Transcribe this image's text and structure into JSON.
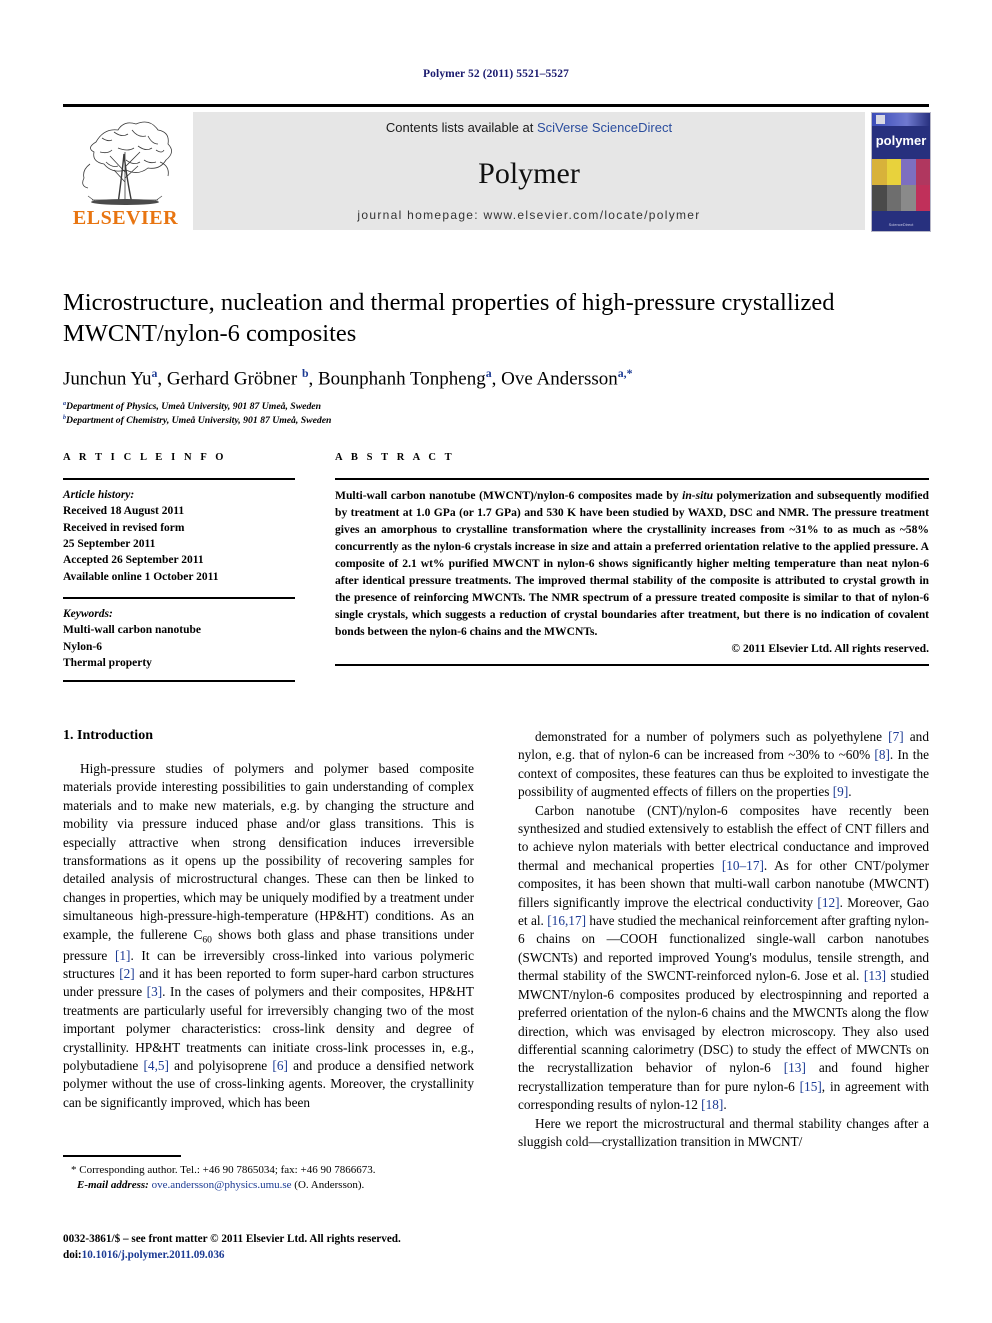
{
  "running_head": "Polymer 52 (2011) 5521–5527",
  "masthead": {
    "contents_prefix": "Contents lists available at ",
    "contents_link": "SciVerse ScienceDirect",
    "journal_name": "Polymer",
    "homepage": "journal homepage: www.elsevier.com/locate/polymer",
    "publisher_logo_text": "ELSEVIER",
    "cover_title": "polymer",
    "cover_footer": "ScienceDirect",
    "accent_link_color": "#2b4d9e",
    "publisher_color": "#e87511",
    "cover_bg_color": "#27307e",
    "panel_bg_color": "#e6e6e6"
  },
  "article": {
    "title": "Microstructure, nucleation and thermal properties of high-pressure crystallized MWCNT/nylon-6 composites",
    "authors_html": "Junchun Yu<sup>a</sup>, Gerhard Gröbner <sup>b</sup>, Bounphanh Tonpheng<sup>a</sup>, Ove Andersson<sup>a,*</sup>",
    "affiliations": [
      {
        "marker": "a",
        "text": "Department of Physics, Umeå University, 901 87 Umeå, Sweden"
      },
      {
        "marker": "b",
        "text": "Department of Chemistry, Umeå University, 901 87 Umeå, Sweden"
      }
    ]
  },
  "info_section": {
    "heading": "A R T I C L E    I N F O",
    "history_label": "Article history:",
    "history_lines": [
      "Received 18 August 2011",
      "Received in revised form",
      "25 September 2011",
      "Accepted 26 September 2011",
      "Available online 1 October 2011"
    ],
    "keywords_label": "Keywords:",
    "keywords": [
      "Multi-wall carbon nanotube",
      "Nylon-6",
      "Thermal property"
    ]
  },
  "abstract_section": {
    "heading": "A B S T R A C T",
    "text_html": "Multi-wall carbon nanotube (MWCNT)/nylon-6 composites made by <i>in-situ</i> polymerization and subsequently modified by treatment at 1.0 GPa (or 1.7 GPa) and 530 K have been studied by WAXD, DSC and NMR. The pressure treatment gives an amorphous to crystalline transformation where the crystallinity increases from ~31% to as much as ~58% concurrently as the nylon-6 crystals increase in size and attain a preferred orientation relative to the applied pressure. A composite of 2.1 wt% purified MWCNT in nylon-6 shows significantly higher melting temperature than neat nylon-6 after identical pressure treatments. The improved thermal stability of the composite is attributed to crystal growth in the presence of reinforcing MWCNTs. The NMR spectrum of a pressure treated composite is similar to that of nylon-6 single crystals, which suggests a reduction of crystal boundaries after treatment, but there is no indication of covalent bonds between the nylon-6 chains and the MWCNTs.",
    "copyright": "© 2011 Elsevier Ltd. All rights reserved."
  },
  "body": {
    "section_title": "1.  Introduction",
    "left_paragraphs_html": [
      "High-pressure studies of polymers and polymer based composite materials provide interesting possibilities to gain understanding of complex materials and to make new materials, e.g. by changing the structure and mobility via pressure induced phase and/or glass transitions. This is especially attractive when strong densification induces irreversible transformations as it opens up the possibility of recovering samples for detailed analysis of microstructural changes. These can then be linked to changes in properties, which may be uniquely modified by a treatment under simultaneous high-pressure-high-temperature (HP&amp;HT) conditions. As an example, the fullerene C<sub>60</sub> shows both glass and phase transitions under pressure <span class=\"ref\">[1]</span>. It can be irreversibly cross-linked into various polymeric structures <span class=\"ref\">[2]</span> and it has been reported to form super-hard carbon structures under pressure <span class=\"ref\">[3]</span>. In the cases of polymers and their composites, HP&amp;HT treatments are particularly useful for irreversibly changing two of the most important polymer characteristics: cross-link density and degree of crystallinity. HP&amp;HT treatments can initiate cross-link processes in, e.g., polybutadiene <span class=\"ref\">[4,5]</span> and polyisoprene <span class=\"ref\">[6]</span> and produce a densified network polymer without the use of cross-linking agents. Moreover, the crystallinity can be significantly improved, which has been"
    ],
    "right_paragraphs_html": [
      "demonstrated for a number of polymers such as polyethylene <span class=\"ref\">[7]</span> and nylon, e.g. that of nylon-6 can be increased from ~30% to ~60% <span class=\"ref\">[8]</span>. In the context of composites, these features can thus be exploited to investigate the possibility of augmented effects of fillers on the properties <span class=\"ref\">[9]</span>.",
      "Carbon nanotube (CNT)/nylon-6 composites have recently been synthesized and studied extensively to establish the effect of CNT fillers and to achieve nylon materials with better electrical conductance and improved thermal and mechanical properties <span class=\"ref\">[10–17]</span>. As for other CNT/polymer composites, it has been shown that multi-wall carbon nanotube (MWCNT) fillers significantly improve the electrical conductivity <span class=\"ref\">[12]</span>. Moreover, Gao et al. <span class=\"ref\">[16,17]</span> have studied the mechanical reinforcement after grafting nylon-6 chains on —COOH functionalized single-wall carbon nanotubes (SWCNTs) and reported improved Young's modulus, tensile strength, and thermal stability of the SWCNT-reinforced nylon-6. Jose et al. <span class=\"ref\">[13]</span> studied MWCNT/nylon-6 composites produced by electrospinning and reported a preferred orientation of the nylon-6 chains and the MWCNTs along the flow direction, which was envisaged by electron microscopy. They also used differential scanning calorimetry (DSC) to study the effect of MWCNTs on the recrystallization behavior of nylon-6 <span class=\"ref\">[13]</span> and found higher recrystallization temperature than for pure nylon-6 <span class=\"ref\">[15]</span>, in agreement with corresponding results of nylon-12 <span class=\"ref\">[18]</span>.",
      "Here we report the microstructural and thermal stability changes after a sluggish cold—crystallization transition in MWCNT/"
    ]
  },
  "footnote": {
    "corresponding_html": "* Corresponding author. Tel.: +46 90 7865034; fax: +46 90 7866673.",
    "email_label": "E-mail address:",
    "email": "ove.andersson@physics.umu.se",
    "email_suffix": "(O. Andersson)."
  },
  "imprint": {
    "line1": "0032-3861/$ – see front matter © 2011 Elsevier Ltd. All rights reserved.",
    "doi_label": "doi:",
    "doi": "10.1016/j.polymer.2011.09.036"
  }
}
